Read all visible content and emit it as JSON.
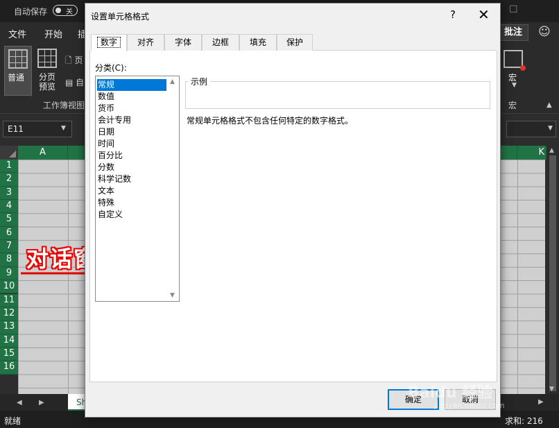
{
  "excel": {
    "autosave_label": "自动保存",
    "autosave_state": "关",
    "menu": [
      "文件",
      "开始",
      "插"
    ],
    "pizhu": "批注",
    "ribbon": {
      "normal_label": "普通",
      "pagebreak_label_1": "分页",
      "pagebreak_label_2": "预览",
      "small_1": "页",
      "small_2": "自",
      "group_label": "工作簿视图",
      "macro_label": "宏",
      "macro_group": "宏"
    },
    "namebox": "E11",
    "columns": [
      "A",
      "K"
    ],
    "rows": [
      "1",
      "2",
      "3",
      "4",
      "5",
      "6",
      "7",
      "8",
      "9",
      "10",
      "11",
      "12",
      "13",
      "14",
      "15",
      "16"
    ],
    "sheet_tab": "Sh",
    "status_ready": "就绪",
    "status_sum": "求和: 216"
  },
  "annotation": {
    "text": "对话窗",
    "color": "#e00000"
  },
  "dialog": {
    "title": "设置单元格格式",
    "help": "?",
    "close": "✕",
    "tabs": [
      "数字",
      "对齐",
      "字体",
      "边框",
      "填充",
      "保护"
    ],
    "active_tab": 0,
    "category_label": "分类(C):",
    "categories": [
      "常规",
      "数值",
      "货币",
      "会计专用",
      "日期",
      "时间",
      "百分比",
      "分数",
      "科学记数",
      "文本",
      "特殊",
      "自定义"
    ],
    "selected_category": 0,
    "sample_label": "示例",
    "description": "常规单元格格式不包含任何特定的数字格式。",
    "ok": "确定",
    "cancel": "取消"
  },
  "watermark": {
    "text": "Baidu 经验",
    "url": "jingyan.baidu.com"
  }
}
